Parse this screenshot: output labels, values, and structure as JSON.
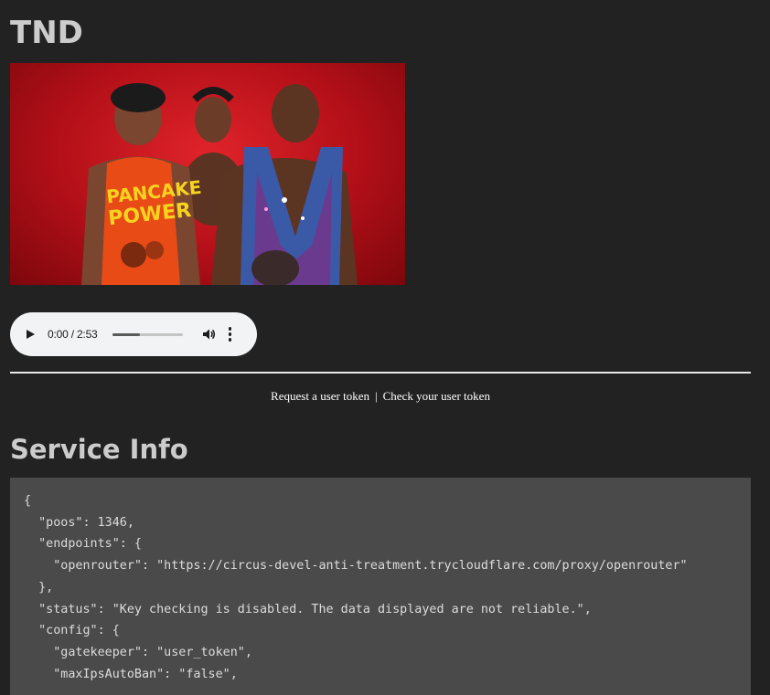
{
  "page": {
    "title": "TND",
    "hero_image": {
      "alt": "image"
    }
  },
  "audio": {
    "time": "0:00 / 2:53",
    "progress": 0.4
  },
  "links": {
    "request_token": "Request a user token",
    "separator": "|",
    "check_token": "Check your user token"
  },
  "service_info": {
    "heading": "Service Info",
    "json_lines": [
      "{",
      "  \"poos\": 1346,",
      "  \"endpoints\": {",
      "    \"openrouter\": \"https://circus-devel-anti-treatment.trycloudflare.com/proxy/openrouter\"",
      "  },",
      "  \"status\": \"Key checking is disabled. The data displayed are not reliable.\",",
      "  \"config\": {",
      "    \"gatekeeper\": \"user_token\",",
      "    \"maxIpsAutoBan\": \"false\","
    ]
  },
  "colors": {
    "background": "#222222",
    "hero_red": "#c0141d",
    "code_bg": "#4a4a4a"
  }
}
